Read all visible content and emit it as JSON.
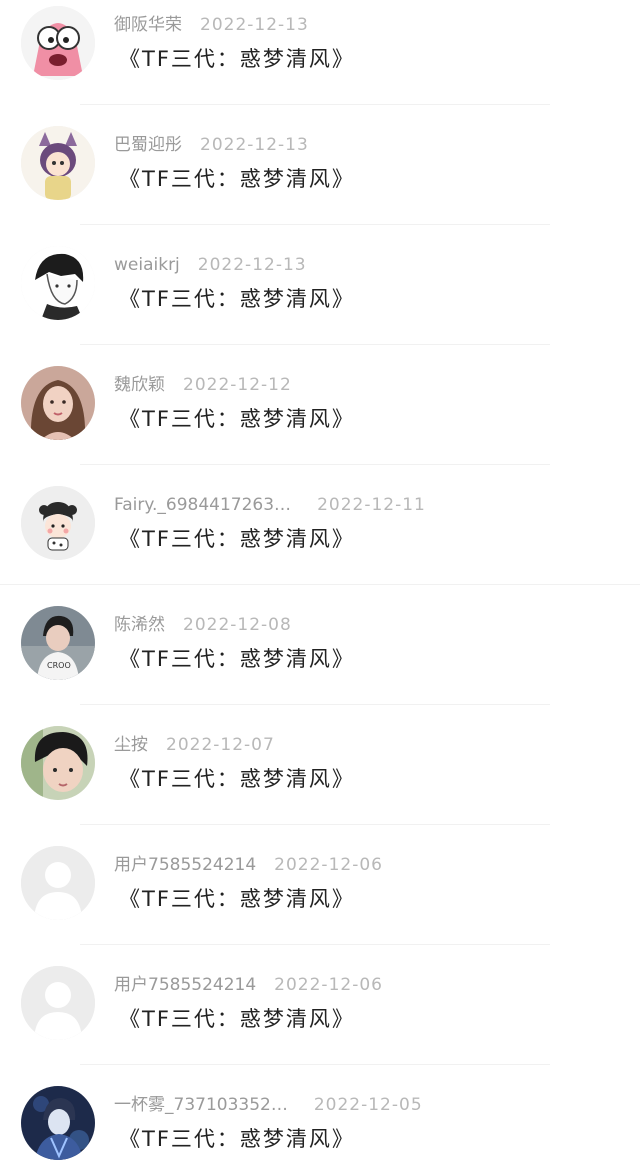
{
  "comments": [
    {
      "name": "御阪华荣",
      "date": "2022-12-13",
      "text": "《TF三代：惑梦清风》",
      "avatar": "cartoon-starfish"
    },
    {
      "name": "巴蜀迎彤",
      "date": "2022-12-13",
      "text": "《TF三代：惑梦清风》",
      "avatar": "anime-cat-girl"
    },
    {
      "name": "weiaikrj",
      "date": "2022-12-13",
      "text": "《TF三代：惑梦清风》",
      "avatar": "sketch-boy"
    },
    {
      "name": "魏欣颖",
      "date": "2022-12-12",
      "text": "《TF三代：惑梦清风》",
      "avatar": "girl-photo"
    },
    {
      "name": "Fairy._6984417263…",
      "date": "2022-12-11",
      "text": "《TF三代：惑梦清风》",
      "avatar": "cartoon-girl"
    },
    {
      "name": "陈浠然",
      "date": "2022-12-08",
      "text": "《TF三代：惑梦清风》",
      "avatar": "boy-photo"
    },
    {
      "name": "尘按",
      "date": "2022-12-07",
      "text": "《TF三代：惑梦清风》",
      "avatar": "boy-closeup-photo"
    },
    {
      "name": "用户7585524214",
      "date": "2022-12-06",
      "text": "《TF三代：惑梦清风》",
      "avatar": "default-user"
    },
    {
      "name": "用户7585524214",
      "date": "2022-12-06",
      "text": "《TF三代：惑梦清风》",
      "avatar": "default-user"
    },
    {
      "name": "一杯雾_737103352…",
      "date": "2022-12-05",
      "text": "《TF三代：惑梦清风》",
      "avatar": "anime-blue-character"
    }
  ],
  "colors": {
    "name": "#9a9a9a",
    "date": "#b8b8b8",
    "text": "#222222",
    "divider": "#f1f1f1"
  }
}
